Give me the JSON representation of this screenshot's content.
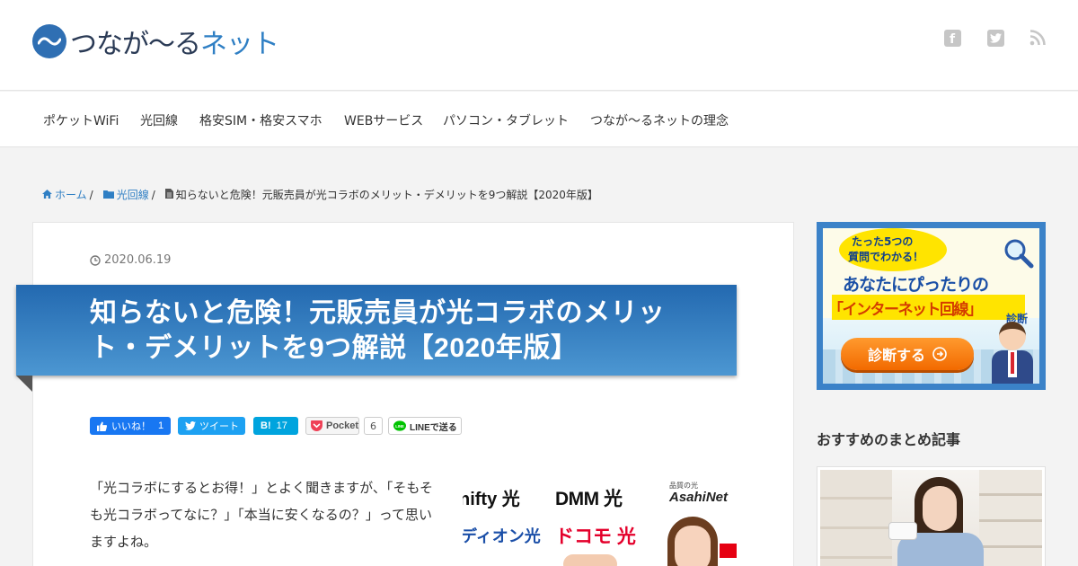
{
  "site": {
    "logo_text_a": "つなが〜る",
    "logo_text_b": "ネット"
  },
  "social_icons": [
    "facebook-icon",
    "twitter-icon",
    "rss-icon"
  ],
  "nav": {
    "items": [
      "ポケットWiFi",
      "光回線",
      "格安SIM・格安スマホ",
      "WEBサービス",
      "パソコン・タブレット",
      "つなが〜るネットの理念"
    ]
  },
  "breadcrumb": {
    "home": "ホーム",
    "category": "光回線",
    "current": "知らないと危険！元販売員が光コラボのメリット・デメリットを9つ解説【2020年版】",
    "separator": "/"
  },
  "article": {
    "date": "2020.06.19",
    "title": "知らないと危険！元販売員が光コラボのメリット・デメリットを9つ解説【2020年版】",
    "intro": "「光コラボにするとお得！」とよく聞きますが、「そもそも光コラボってなに？」「本当に安くなるの？」って思いますよね。"
  },
  "share": {
    "like_label": "いいね！",
    "like_count": "1",
    "tweet_label": "ツイート",
    "hatena_label": "B!",
    "hatena_count": "17",
    "pocket_label": "Pocket",
    "pocket_count": "6",
    "line_label": "LINEで送る"
  },
  "hero_brands": {
    "nifty": "nifty 光",
    "dmm": "DMM 光",
    "asahi_small": "品質の光",
    "asahi": "AsahiNet",
    "dion": "ディオン光",
    "docomo": "ドコモ 光"
  },
  "sidebar": {
    "banner": {
      "line1": "たった5つの",
      "line2": "質問でわかる！",
      "line3": "あなたにぴったりの",
      "line4": "「インターネット回線」",
      "line5": "診断",
      "button": "診断する"
    },
    "heading": "おすすめのまとめ記事"
  },
  "colors": {
    "accent": "#2f7fc4",
    "title_band_top": "#2369b0",
    "title_band_bottom": "#4c97d2",
    "like": "#1877f2",
    "tweet": "#1da1f2",
    "hatena": "#00a4de",
    "pocket": "#ef4056",
    "line": "#00c300"
  }
}
